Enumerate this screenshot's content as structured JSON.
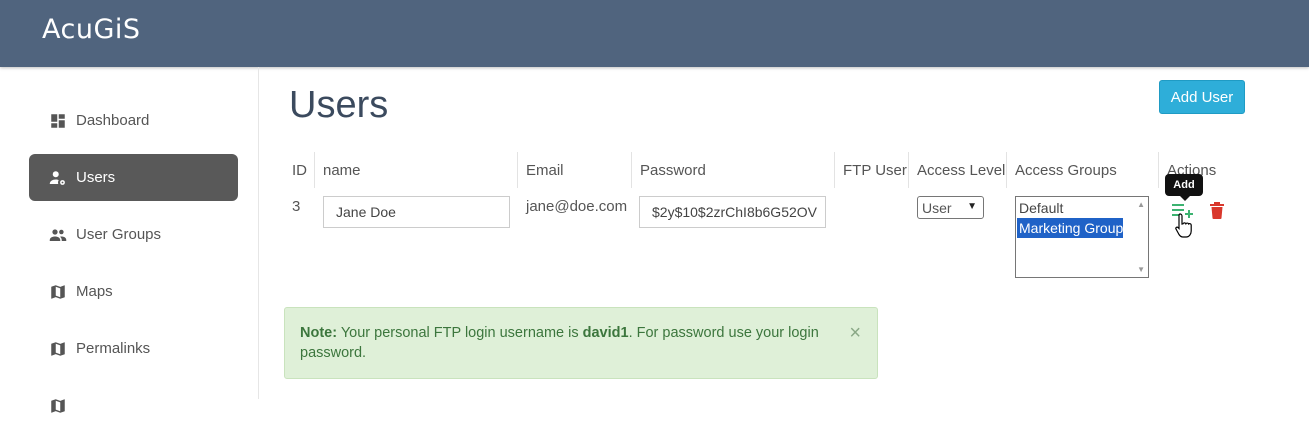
{
  "app": {
    "logo_text": "AcuGiS"
  },
  "sidebar": {
    "items": [
      {
        "label": "Dashboard",
        "icon": "dashboard-icon",
        "active": false
      },
      {
        "label": "Users",
        "icon": "user-gear-icon",
        "active": true
      },
      {
        "label": "User Groups",
        "icon": "users-icon",
        "active": false
      },
      {
        "label": "Maps",
        "icon": "map-icon",
        "active": false
      },
      {
        "label": "Permalinks",
        "icon": "map-icon",
        "active": false
      }
    ]
  },
  "page": {
    "title": "Users",
    "add_user_label": "Add User"
  },
  "table": {
    "headers": [
      "ID",
      "name",
      "Email",
      "Password",
      "FTP User",
      "Access Level",
      "Access Groups",
      "Actions"
    ],
    "rows": [
      {
        "id": "3",
        "name": "Jane Doe",
        "email": "jane@doe.com",
        "password": "$2y$10$2zrChI8b6G52OV",
        "ftp_user": "",
        "access_level": "User",
        "access_groups": [
          {
            "label": "Default",
            "selected": false
          },
          {
            "label": "Marketing Group",
            "selected": true
          }
        ]
      }
    ]
  },
  "tooltip": {
    "text": "Add"
  },
  "alert": {
    "prefix": "Note:",
    "text_before": " Your personal FTP login username is ",
    "username": "david1",
    "text_after": ". For password use your login password.",
    "close": "×"
  },
  "colors": {
    "header_bg": "#50647e",
    "active_nav": "#595959",
    "add_button": "#2eaed9",
    "delete": "#d9372c",
    "add_icon": "#3cb371"
  }
}
